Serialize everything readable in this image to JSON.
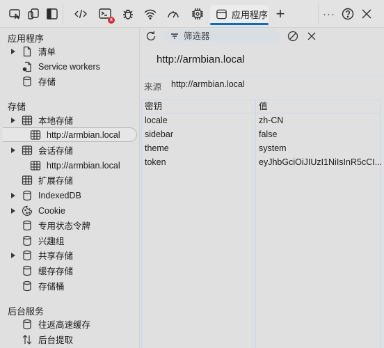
{
  "toolbar": {
    "icons": [
      "inspect-icon",
      "device-emulation-icon",
      "dock-sidebar-icon",
      "elements-icon",
      "console-icon",
      "sources-bug-icon",
      "network-wifi-icon",
      "performance-gauge-icon",
      "memory-chip-icon"
    ],
    "console_error_badge": "x",
    "active_tab": {
      "label": "应用程序",
      "icon": "application-window-icon"
    },
    "add_tab_label": "+",
    "more_label": "···",
    "help_label": "?",
    "close_label": "✕",
    "accent_color": "#0f6cbd"
  },
  "sidebar": {
    "sections": [
      {
        "title": "应用程序",
        "items": [
          {
            "label": "清单",
            "icon": "document-icon",
            "expandable": true
          },
          {
            "label": "Service workers",
            "icon": "service-worker-icon",
            "expandable": false
          },
          {
            "label": "存储",
            "icon": "database-icon",
            "expandable": false
          }
        ]
      },
      {
        "title": "存储",
        "items": [
          {
            "label": "本地存储",
            "icon": "table-icon",
            "expandable": true
          },
          {
            "label": "http://armbian.local",
            "icon": "table-icon",
            "expandable": false,
            "selected": true
          },
          {
            "label": "会话存储",
            "icon": "table-icon",
            "expandable": true
          },
          {
            "label": "http://armbian.local",
            "icon": "table-icon",
            "expandable": false
          },
          {
            "label": "扩展存储",
            "icon": "table-icon",
            "expandable": false
          },
          {
            "label": "IndexedDB",
            "icon": "database-icon",
            "expandable": true
          },
          {
            "label": "Cookie",
            "icon": "cookie-icon",
            "expandable": true
          },
          {
            "label": "专用状态令牌",
            "icon": "database-icon",
            "expandable": false
          },
          {
            "label": "兴趣组",
            "icon": "database-icon",
            "expandable": false
          },
          {
            "label": "共享存储",
            "icon": "database-icon",
            "expandable": true
          },
          {
            "label": "缓存存储",
            "icon": "database-icon",
            "expandable": false
          },
          {
            "label": "存储桶",
            "icon": "database-icon",
            "expandable": false
          }
        ]
      },
      {
        "title": "后台服务",
        "items": [
          {
            "label": "往返高速缓存",
            "icon": "database-icon",
            "expandable": false
          },
          {
            "label": "后台提取",
            "icon": "up-down-arrows-icon",
            "expandable": false
          }
        ]
      }
    ]
  },
  "panel": {
    "filter_placeholder": "筛选器",
    "filter_value": "",
    "origin_title": "http://armbian.local",
    "origin_label": "来源",
    "origin_value": "http://armbian.local",
    "table": {
      "columns": [
        "密钥",
        "值"
      ],
      "rows": [
        [
          "locale",
          "zh-CN"
        ],
        [
          "sidebar",
          "false"
        ],
        [
          "theme",
          "system"
        ],
        [
          "token",
          "eyJhbGciOiJIUzI1NiIsInR5cCI..."
        ]
      ]
    }
  }
}
